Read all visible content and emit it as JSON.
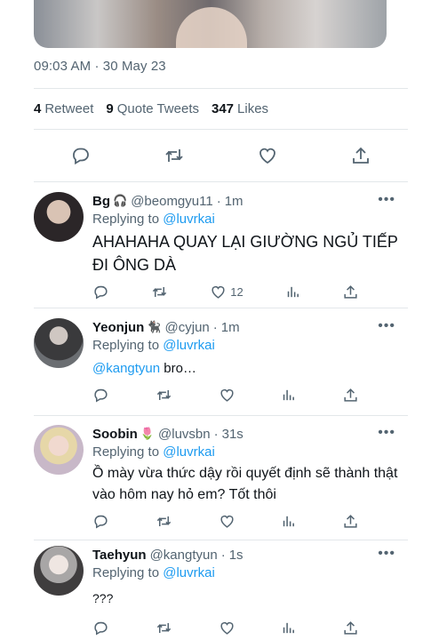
{
  "tweet": {
    "timestamp": "09:03 AM · 30 May 23",
    "stats": {
      "retweets_count": "4",
      "retweets_label": "Retweet",
      "quotes_count": "9",
      "quotes_label": "Quote Tweets",
      "likes_count": "347",
      "likes_label": "Likes"
    }
  },
  "icons": {
    "reply": "reply-icon",
    "retweet": "retweet-icon",
    "like": "heart-icon",
    "share": "share-icon",
    "analytics": "analytics-icon",
    "more": "more-icon"
  },
  "replies": [
    {
      "name": "Bg",
      "emoji": "🎧",
      "handle": "@beomgyu11",
      "time": "1m",
      "replying_label": "Replying to",
      "replying_to": "@luvrkai",
      "text": "AHAHAHA QUAY LẠI GIƯỜNG NGỦ TIẾP ĐI ÔNG DÀ",
      "like_count": "12"
    },
    {
      "name": "Yeonjun",
      "emoji": "🐈‍⬛",
      "handle": "@cyjun",
      "time": "1m",
      "replying_label": "Replying to",
      "replying_to": "@luvrkai",
      "mention": "@kangtyun",
      "text": "bro…"
    },
    {
      "name": "Soobin",
      "emoji": "🌷",
      "handle": "@luvsbn",
      "time": "31s",
      "replying_label": "Replying to",
      "replying_to": "@luvrkai",
      "text": "Ồ mày vừa thức dậy rồi quyết định sẽ thành thật vào hôm nay hỏ em? Tốt thôi"
    },
    {
      "name": "Taehyun",
      "handle": "@kangtyun",
      "time": "1s",
      "replying_label": "Replying to",
      "replying_to": "@luvrkai",
      "text": "???"
    }
  ],
  "more_glyph": "•••"
}
